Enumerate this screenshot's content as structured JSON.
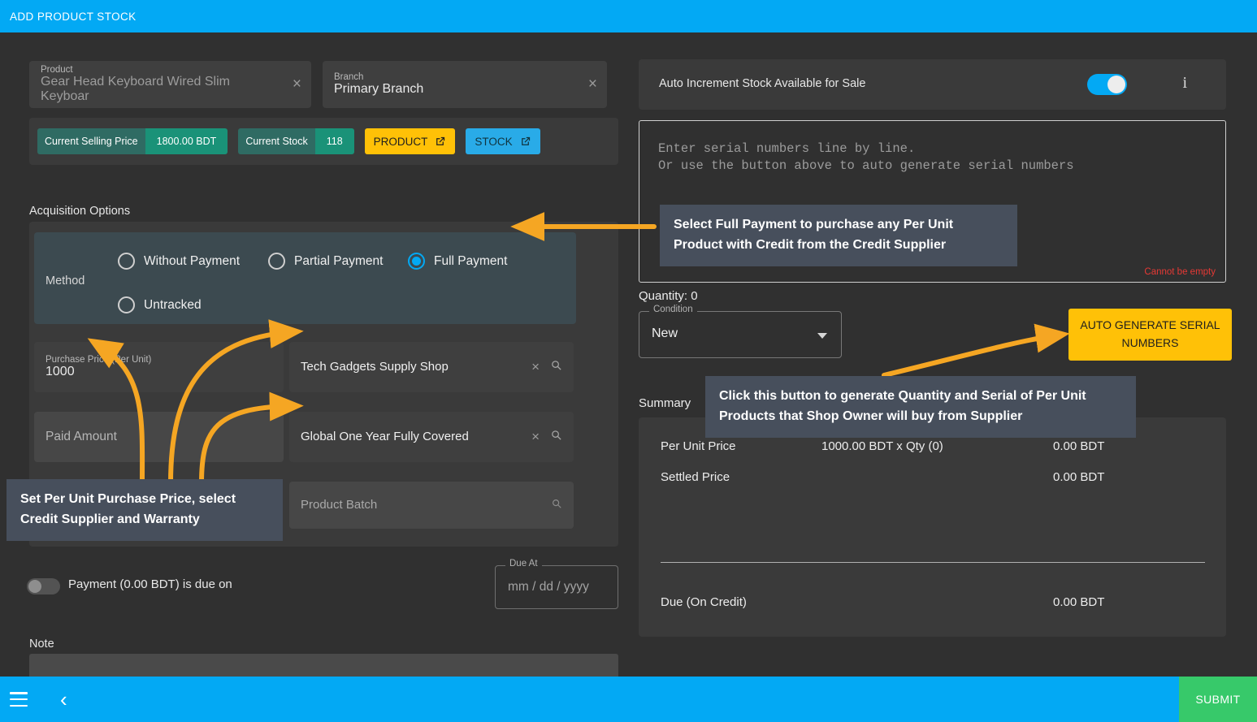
{
  "header": {
    "title": "ADD PRODUCT STOCK"
  },
  "product": {
    "label": "Product",
    "value": "Gear Head Keyboard Wired Slim Keyboar",
    "clear_icon": "×"
  },
  "branch": {
    "label": "Branch",
    "value": "Primary Branch",
    "clear_icon": "×"
  },
  "chips": {
    "items": [
      {
        "key": "Current Selling Price",
        "value": "1800.00 BDT"
      },
      {
        "key": "Current Stock",
        "value": "118"
      }
    ],
    "buttons": [
      {
        "label": "PRODUCT",
        "style": "amber"
      },
      {
        "label": "STOCK",
        "style": "blue"
      }
    ]
  },
  "acquisition": {
    "section_title": "Acquisition Options",
    "method_label": "Method",
    "methods": [
      {
        "label": "Without Payment",
        "selected": false
      },
      {
        "label": "Partial Payment",
        "selected": false
      },
      {
        "label": "Full Payment",
        "selected": true
      },
      {
        "label": "Untracked",
        "selected": false
      }
    ],
    "purchase_price": {
      "label": "Purchase Price (Per Unit)",
      "value": "1000"
    },
    "paid_amount": {
      "placeholder": "Paid Amount",
      "value": ""
    },
    "supplier": {
      "value": "Tech Gadgets Supply Shop"
    },
    "warranty": {
      "value": "Global One Year Fully Covered"
    },
    "batch": {
      "placeholder": "Product Batch"
    }
  },
  "due": {
    "toggle_on": false,
    "text": "Payment (0.00 BDT) is due on",
    "due_at_label": "Due At",
    "due_at_placeholder": "mm / dd / yyyy"
  },
  "note": {
    "label": "Note",
    "value": ""
  },
  "auto_increment": {
    "label": "Auto Increment Stock Available for Sale",
    "toggle_on": true,
    "info_icon": "i"
  },
  "serial": {
    "placeholder": "Enter serial numbers line by line.\nOr use the button above to auto generate serial numbers",
    "error": "Cannot be empty"
  },
  "quantity_text": "Quantity: 0",
  "condition": {
    "label": "Condition",
    "value": "New",
    "options": [
      "New"
    ]
  },
  "auto_generate_button": "AUTO GENERATE SERIAL NUMBERS",
  "summary": {
    "label": "Summary",
    "rows": [
      {
        "key": "Per Unit Price",
        "middle": "1000.00 BDT x Qty (0)",
        "value": "0.00 BDT"
      },
      {
        "key": "Settled Price",
        "middle": "",
        "value": "0.00 BDT"
      }
    ],
    "total": {
      "key": "Due (On Credit)",
      "value": "0.00 BDT"
    }
  },
  "tooltips": {
    "full_payment": "Select Full Payment to purchase any Per Unit Product with Credit from the Credit Supplier",
    "left_fields": "Set Per Unit Purchase Price, select Credit Supplier and Warranty",
    "auto_generate": "Click this button to generate Quantity and Serial of Per Unit Products that Shop Owner will buy from Supplier"
  },
  "bottombar": {
    "menu_icon": "hamburger-icon",
    "back_icon": "‹",
    "submit_label": "SUBMIT"
  },
  "colors": {
    "accent_blue": "#03A9F4",
    "amber": "#FFC107",
    "teal_key": "#2f6b63",
    "teal_value": "#1a9278",
    "submit_green": "#37c96a",
    "tooltip_bg": "#474f5c",
    "arrow": "#F5A623",
    "error_red": "#e53935",
    "method_panel": "#3c4a50"
  }
}
